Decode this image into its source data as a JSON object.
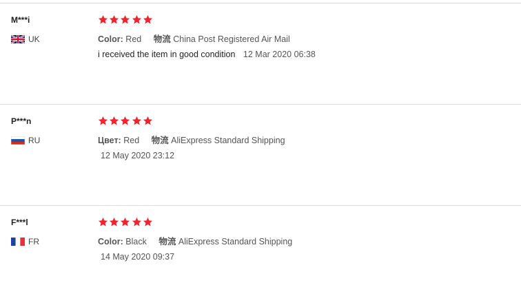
{
  "reviews": [
    {
      "user": "M***i",
      "country": "UK",
      "flag": "uk-flag-icon",
      "rating": 5,
      "attr_key": "Color:",
      "attr_value": "Red",
      "shipping_key": "物流",
      "shipping_value": "China Post Registered Air Mail",
      "feedback": "i received the item in good condition",
      "date": "12 Mar 2020 06:38"
    },
    {
      "user": "P***n",
      "country": "RU",
      "flag": "ru-flag-icon",
      "rating": 5,
      "attr_key": "Цвет:",
      "attr_value": "Red",
      "shipping_key": "物流",
      "shipping_value": "AliExpress Standard Shipping",
      "feedback": "",
      "date": "12 May 2020 23:12"
    },
    {
      "user": "F***l",
      "country": "FR",
      "flag": "fr-flag-icon",
      "rating": 5,
      "attr_key": "Color:",
      "attr_value": "Black",
      "shipping_key": "物流",
      "shipping_value": "AliExpress Standard Shipping",
      "feedback": "",
      "date": "14 May 2020 09:37"
    }
  ],
  "colors": {
    "star": "#f5222d",
    "divider": "#dcdcdc"
  }
}
